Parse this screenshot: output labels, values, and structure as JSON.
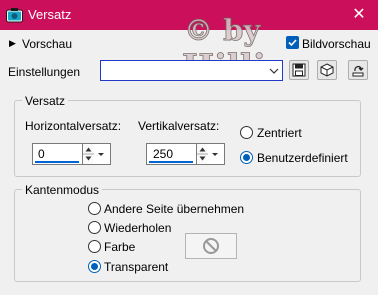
{
  "window": {
    "title": "Versatz",
    "close_glyph": "✕",
    "icon": "psp-camera-icon"
  },
  "watermark": {
    "line1": "© by",
    "line2": "Hilli"
  },
  "preview": {
    "vorschau_label": "Vorschau",
    "bildvorschau_label": "Bildvorschau",
    "bildvorschau_checked": true
  },
  "settings": {
    "label": "Einstellungen",
    "combo_value": ""
  },
  "offset": {
    "title": "Versatz",
    "horizontal_label": "Horizontalversatz:",
    "horizontal_value": "0",
    "vertical_label": "Vertikalversatz:",
    "vertical_value": "250",
    "options": [
      {
        "label": "Zentriert",
        "selected": false
      },
      {
        "label": "Benutzerdefiniert",
        "selected": true
      }
    ]
  },
  "edge_mode": {
    "title": "Kantenmodus",
    "options": [
      {
        "label": "Andere Seite übernehmen",
        "selected": false
      },
      {
        "label": "Wiederholen",
        "selected": false
      },
      {
        "label": "Farbe",
        "selected": false
      },
      {
        "label": "Transparent",
        "selected": true
      }
    ]
  },
  "colors": {
    "titlebar": "#cc0f5a",
    "accent": "#005fb8",
    "focus_border": "#1f3ac9"
  }
}
